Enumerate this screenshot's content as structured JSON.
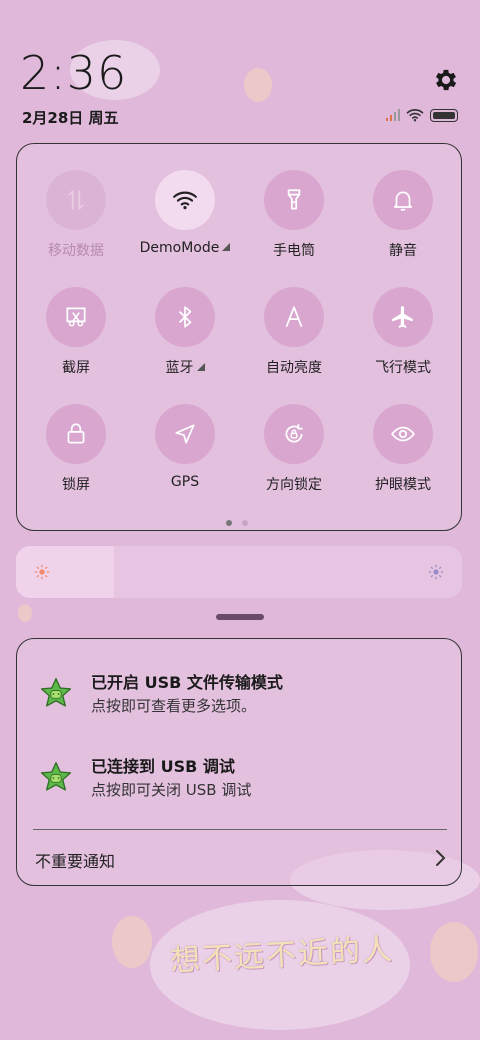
{
  "status": {
    "time": "2:36",
    "date": "2月28日 周五"
  },
  "icons": {
    "settings": "gear-icon",
    "signal": "signal-icon",
    "wifi": "wifi-icon",
    "battery": "battery-icon"
  },
  "quick_settings": {
    "tiles": [
      {
        "label": "移动数据",
        "icon": "mobile-data-icon",
        "state": "disabled"
      },
      {
        "label": "DemoMode",
        "icon": "wifi-icon",
        "state": "on",
        "expandable": true
      },
      {
        "label": "手电筒",
        "icon": "flashlight-icon",
        "state": "off"
      },
      {
        "label": "静音",
        "icon": "bell-icon",
        "state": "off"
      },
      {
        "label": "截屏",
        "icon": "screenshot-icon",
        "state": "off"
      },
      {
        "label": "蓝牙",
        "icon": "bluetooth-icon",
        "state": "off",
        "expandable": true
      },
      {
        "label": "自动亮度",
        "icon": "auto-brightness-icon",
        "state": "off"
      },
      {
        "label": "飞行模式",
        "icon": "airplane-icon",
        "state": "off"
      },
      {
        "label": "锁屏",
        "icon": "lock-icon",
        "state": "off"
      },
      {
        "label": "GPS",
        "icon": "location-icon",
        "state": "off"
      },
      {
        "label": "方向锁定",
        "icon": "rotation-lock-icon",
        "state": "off"
      },
      {
        "label": "护眼模式",
        "icon": "eye-icon",
        "state": "off"
      }
    ],
    "page_count": 2,
    "current_page": 1
  },
  "brightness": {
    "level": 0.22
  },
  "notifications": {
    "items": [
      {
        "title": "已开启 USB 文件传输模式",
        "subtitle": "点按即可查看更多选项。",
        "icon": "android-star-icon"
      },
      {
        "title": "已连接到 USB 调试",
        "subtitle": "点按即可关闭 USB 调试",
        "icon": "android-star-icon"
      }
    ],
    "footer_label": "不重要通知"
  },
  "wallpaper": {
    "sticker_text": "想不远不近的人"
  },
  "colors": {
    "background": "#dfb8da",
    "tile_bg": "#d9a6cf",
    "tile_active": "#f2dbee"
  }
}
